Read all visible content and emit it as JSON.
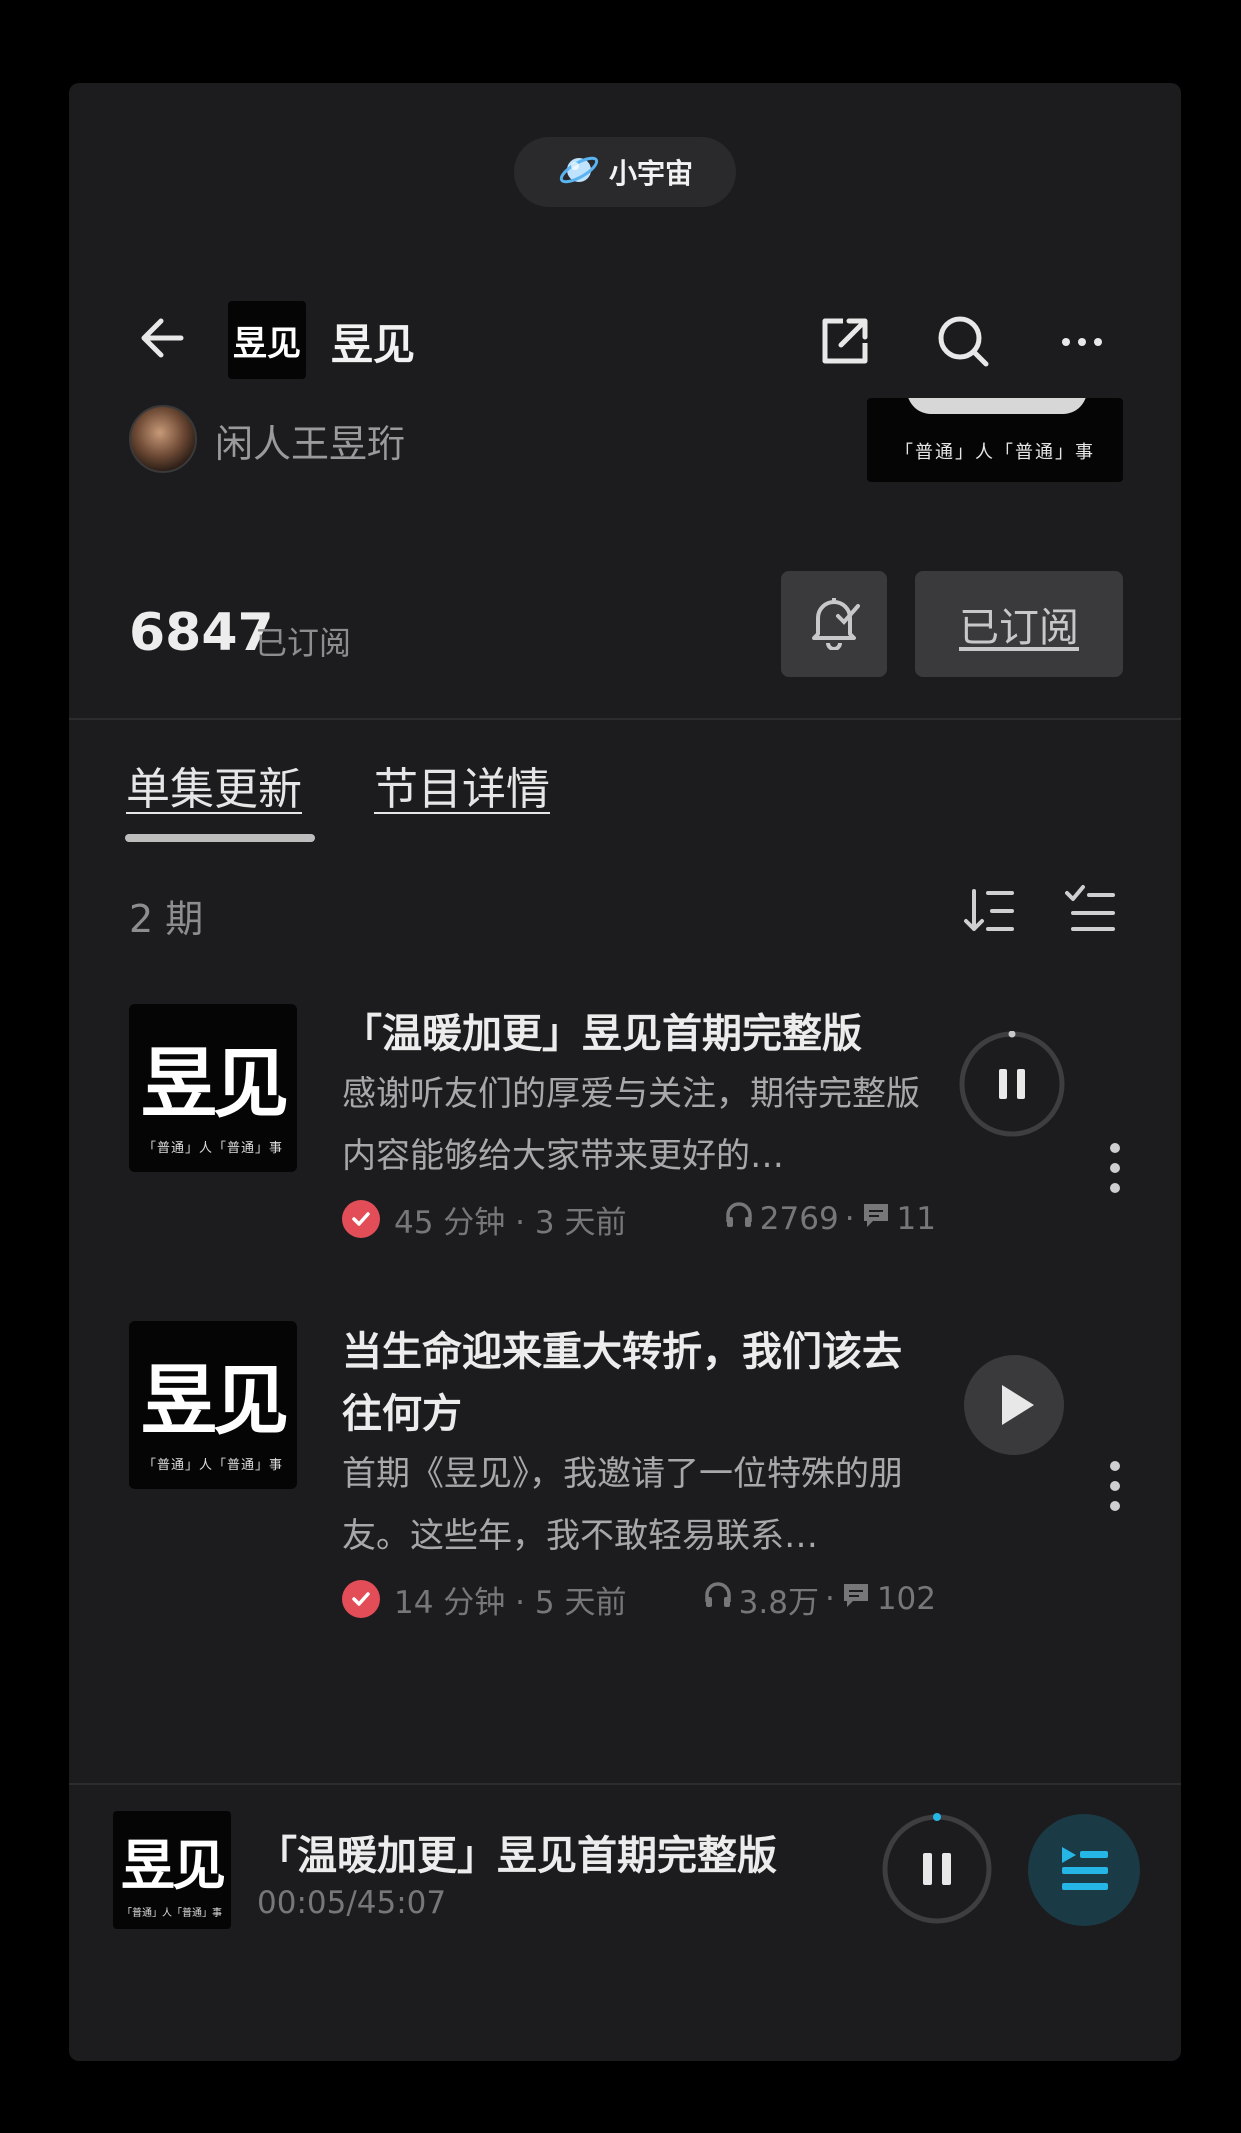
{
  "brand": {
    "name": "小宇宙",
    "icon": "planet-icon"
  },
  "header": {
    "title": "昱见",
    "cover_text": "昱见"
  },
  "author": {
    "name": "闲人王昱珩"
  },
  "banner": {
    "caption": "「普通」人「普通」事"
  },
  "subscription": {
    "count": "6847",
    "label": "已订阅",
    "button_label": "已订阅"
  },
  "tabs": [
    {
      "label": "单集更新",
      "active": true
    },
    {
      "label": "节目详情",
      "active": false
    }
  ],
  "episode_count": "2 期",
  "episodes": [
    {
      "cover_text": "昱见",
      "cover_caption": "「普通」人「普通」事",
      "title": "「温暖加更」昱见首期完整版",
      "description": "感谢听友们的厚爱与关注，期待完整版内容能够给大家带来更好的…",
      "duration_age": "45 分钟 · 3 天前",
      "plays": "2769",
      "dot": "·",
      "comments": "11",
      "state": "playing",
      "progress": 0.0018
    },
    {
      "cover_text": "昱见",
      "cover_caption": "「普通」人「普通」事",
      "title": "当生命迎来重大转折，我们该去往何方",
      "description": "首期《昱见》，我邀请了一位特殊的朋友。这些年，我不敢轻易联系…",
      "duration_age": "14 分钟 · 5 天前",
      "plays": "3.8万",
      "dot": "·",
      "comments": "102",
      "state": "paused"
    }
  ],
  "mini_player": {
    "cover_text": "昱见",
    "cover_caption": "「普通」人「普通」事",
    "title": "「温暖加更」昱见首期完整版",
    "time": "00:05/45:07",
    "progress": 0.0018
  },
  "colors": {
    "background": "#1c1c1e",
    "played_badge": "#e24d57",
    "accent": "#26b6e6",
    "button_bg": "#3a3a3c"
  }
}
